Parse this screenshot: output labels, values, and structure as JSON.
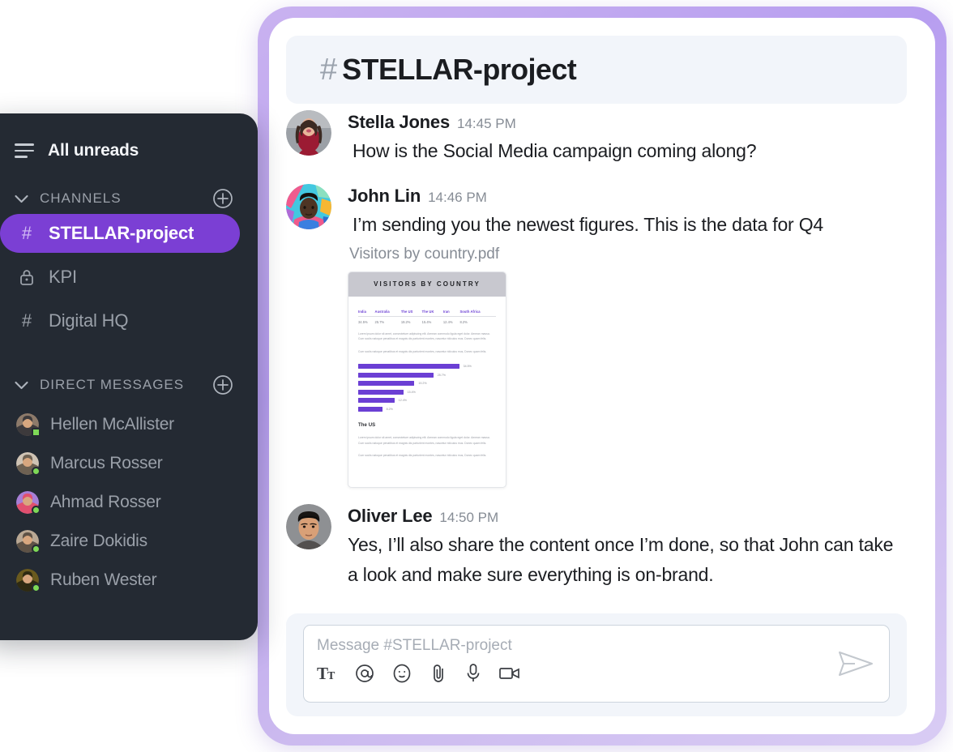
{
  "sidebar": {
    "top_item": {
      "label": "All unreads",
      "icon": "hamburger-icon"
    },
    "sections": [
      {
        "label": "CHANNELS",
        "add_icon": "plus-circle-icon"
      },
      {
        "label": "DIRECT MESSAGES",
        "add_icon": "plus-circle-icon"
      }
    ],
    "channels": [
      {
        "name": "STELLAR-project",
        "icon": "hash-icon",
        "active": true
      },
      {
        "name": "KPI",
        "icon": "lock-icon",
        "active": false
      },
      {
        "name": "Digital HQ",
        "icon": "hash-icon",
        "active": false
      }
    ],
    "direct_messages": [
      {
        "name": "Hellen McAllister",
        "status": "online",
        "status_shape": "square",
        "avatar_colors": [
          "#8d7a6a",
          "#3d3a3c"
        ]
      },
      {
        "name": "Marcus Rosser",
        "status": "online",
        "status_shape": "circle",
        "avatar_colors": [
          "#cfc3b4",
          "#6e6152"
        ]
      },
      {
        "name": "Ahmad Rosser",
        "status": "online",
        "status_shape": "circle",
        "avatar_colors": [
          "#a77fd6",
          "#e0506f"
        ]
      },
      {
        "name": "Zaire Dokidis",
        "status": "online",
        "status_shape": "circle",
        "avatar_colors": [
          "#b9a894",
          "#5e5246"
        ]
      },
      {
        "name": "Ruben Wester",
        "status": "online",
        "status_shape": "circle",
        "avatar_colors": [
          "#6a5a1e",
          "#2e2a12"
        ]
      }
    ],
    "accent_color": "#7B3FD4",
    "background_color": "#242a33"
  },
  "header": {
    "hash": "#",
    "channel_name": "STELLAR-project"
  },
  "messages": [
    {
      "author": "Stella Jones",
      "time": "14:45 PM",
      "text": "How is the Social Media campaign coming along?",
      "avatar_colors": [
        "#8c8f96",
        "#9b1b33"
      ]
    },
    {
      "author": "John Lin",
      "time": "14:46 PM",
      "text": "I’m sending you the newest figures. This is the data for Q4",
      "avatar_colors": [
        "#43c8e0",
        "#f05b8e"
      ],
      "attachment": {
        "file_name": "Visitors by country.pdf",
        "preview_title": "VISITORS BY COUNTRY"
      }
    },
    {
      "author": "Oliver Lee",
      "time": "14:50 PM",
      "text": "Yes, I’ll also share the content once I’m done, so that John can take a look and make sure everything is on-brand.",
      "avatar_colors": [
        "#8e9093",
        "#4a4442"
      ]
    }
  ],
  "chart_data": {
    "type": "bar",
    "title": "VISITORS BY COUNTRY",
    "orientation": "horizontal",
    "categories": [
      "India",
      "Australia",
      "The US",
      "The UK",
      "Iran",
      "South Africa"
    ],
    "values": [
      34.5,
      25.7,
      19.2,
      15.4,
      12.4,
      8.2
    ],
    "value_labels": [
      "34.5%",
      "25.7%",
      "19.2%",
      "15.4%",
      "12.4%",
      "8.2%"
    ],
    "xlabel": "",
    "ylabel": "",
    "xlim": [
      0,
      36
    ],
    "grid": false,
    "legend": "none",
    "bar_color": "#6b3fd4",
    "table": {
      "headers": [
        "India",
        "Australia",
        "The US",
        "The UK",
        "Iran",
        "South Africa"
      ],
      "rows": [
        [
          "34.5%",
          "25.7%",
          "19.2%",
          "15.4%",
          "12.4%",
          "8.2%"
        ]
      ]
    },
    "sections": [
      {
        "heading": "",
        "paragraphs": [
          "Lorem ipsum dolor sit amet, consectetuer adipiscing elit. Aenean commodo ligula eget dolor. Aenean massa. Cum sociis natoque penatibus et magnis dis parturient montes, nascetur ridiculus mus. Donec quam felis.",
          "Cum sociis natoque penatibus et magnis dis parturient montes, nascetur ridiculus mus, Donec quam felis."
        ]
      },
      {
        "heading": "The US",
        "paragraphs": [
          "Lorem ipsum dolor sit amet, consectetuer adipiscing elit. Aenean commodo ligula eget dolor. Aenean massa. Cum sociis natoque penatibus et magnis dis parturient montes, nascetur ridiculus mus. Donec quam felis.",
          "Cum sociis natoque penatibus et magnis dis parturient montes, nascetur ridiculus mus, Donec quam felis."
        ]
      }
    ]
  },
  "composer": {
    "placeholder": "Message #STELLAR-project",
    "value": "",
    "tools": [
      {
        "name": "text-format-icon",
        "label": "Tt"
      },
      {
        "name": "mention-icon",
        "label": "@"
      },
      {
        "name": "emoji-icon",
        "label": "emoji"
      },
      {
        "name": "attachment-icon",
        "label": "paperclip"
      },
      {
        "name": "microphone-icon",
        "label": "mic"
      },
      {
        "name": "video-icon",
        "label": "video"
      }
    ],
    "send_icon": "send-icon"
  }
}
